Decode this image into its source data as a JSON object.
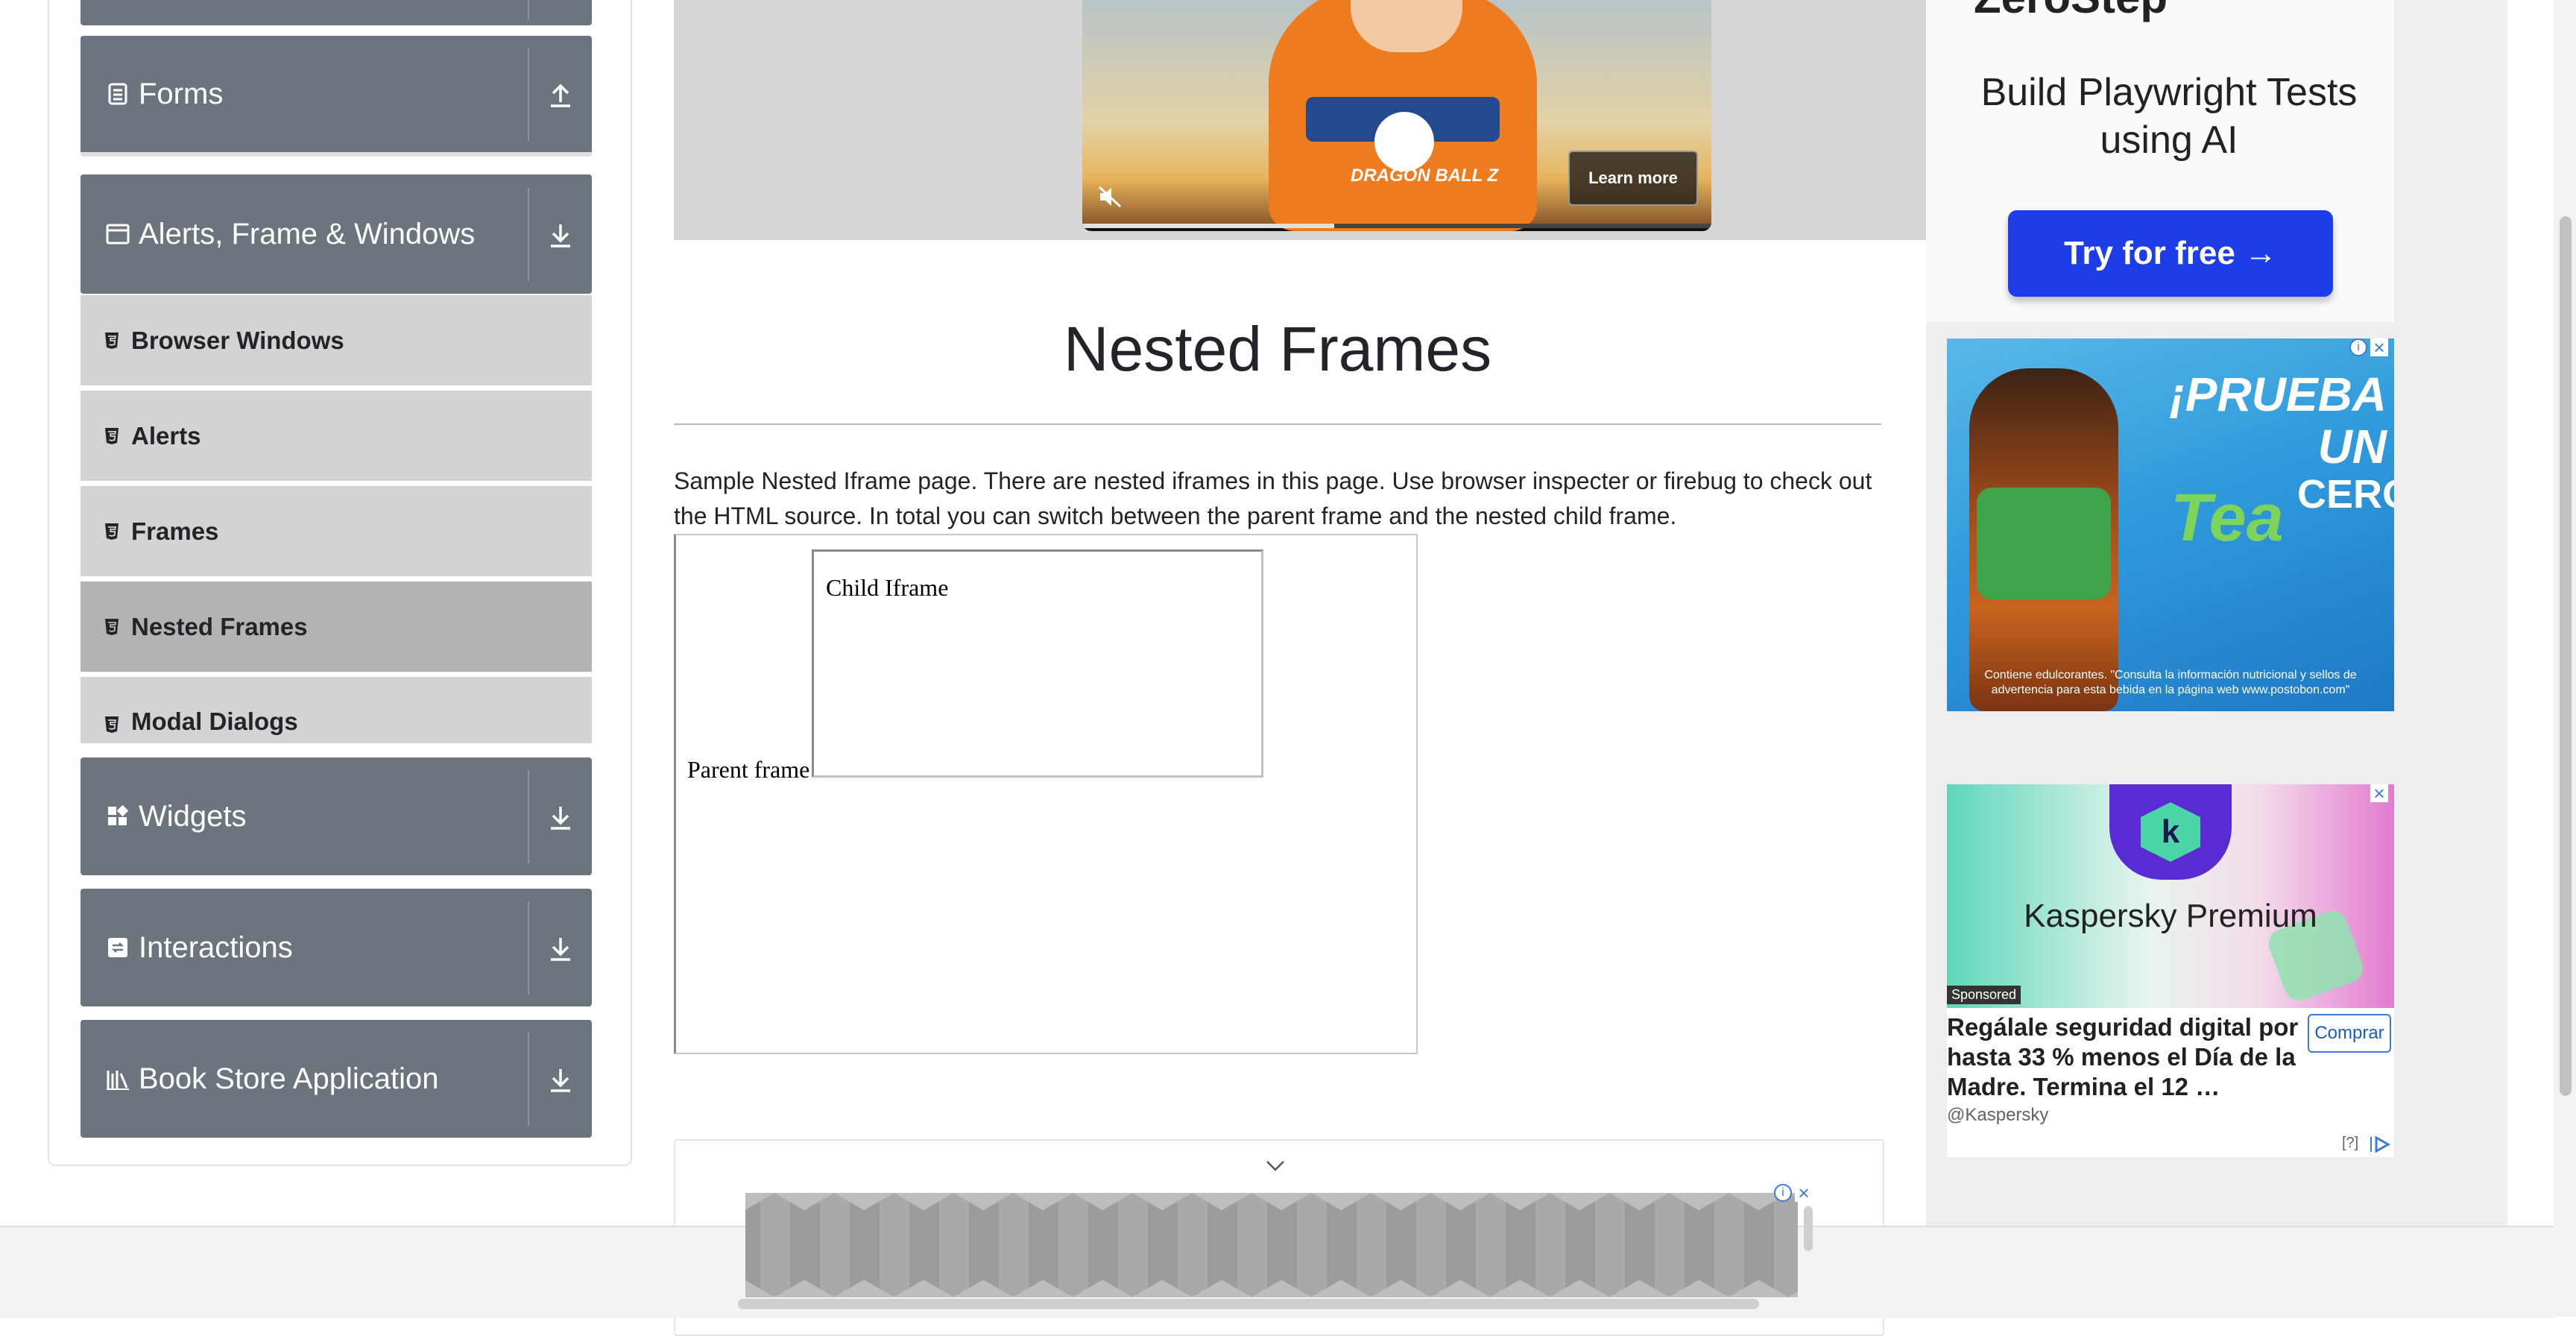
{
  "sidebar": {
    "groups": [
      {
        "label": "Forms",
        "expanded": true
      },
      {
        "label": "Alerts, Frame & Windows",
        "expanded": true
      },
      {
        "label": "Widgets",
        "expanded": false
      },
      {
        "label": "Interactions",
        "expanded": false
      },
      {
        "label": "Book Store Application",
        "expanded": false
      }
    ],
    "items": [
      {
        "label": "Browser Windows"
      },
      {
        "label": "Alerts"
      },
      {
        "label": "Frames"
      },
      {
        "label": "Nested Frames",
        "active": true
      },
      {
        "label": "Modal Dialogs"
      }
    ]
  },
  "video_ad": {
    "learn_more": "Learn more",
    "logo": "DRAGON BALL Z",
    "progress_fraction": 0.4
  },
  "main": {
    "title": "Nested Frames",
    "description": "Sample Nested Iframe page. There are nested iframes in this page. Use browser inspecter or firebug to check out the HTML source. In total you can switch between the parent frame and the nested child frame.",
    "parent_frame_text": "Parent frame",
    "child_frame_text": "Child Iframe"
  },
  "ads": {
    "zerostep": {
      "logo": "ZeroStep",
      "headline": "Build Playwright Tests using AI",
      "button": "Try for free →"
    },
    "tea": {
      "headline": "¡PRUEBA UN",
      "brand": "Tea",
      "cero": "CERO",
      "legal": "Contiene edulcorantes. \"Consulta la información nutricional y sellos de advertencia para esta bebida en la página web www.postobon.com\""
    },
    "kaspersky": {
      "title": "Kaspersky Premium",
      "sponsored": "Sponsored",
      "copy": "Regálale seguridad digital por hasta 33 % menos el Día de la Madre. Termina el 12 …",
      "handle": "@Kaspersky",
      "button": "Comprar",
      "footer": "[?]"
    }
  },
  "colors": {
    "sidebar_header": "#6c757d",
    "sidebar_item": "#d3d3d3",
    "sidebar_item_active": "#b3b3b3",
    "cta_blue": "#1d3de6"
  }
}
